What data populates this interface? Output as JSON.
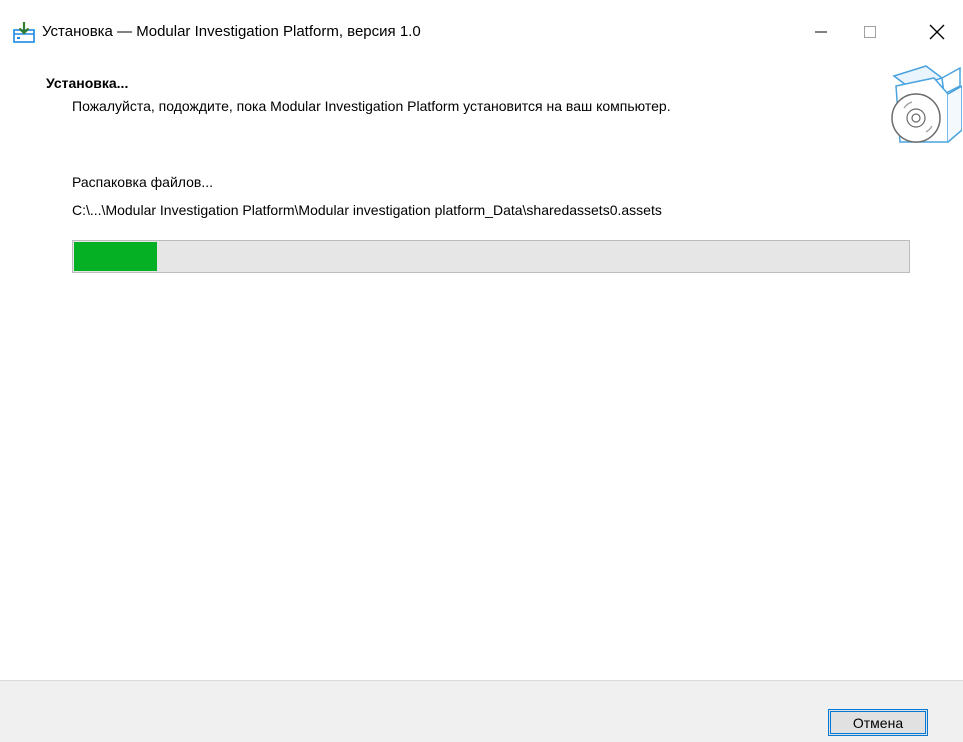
{
  "window": {
    "title": "Установка — Modular Investigation Platform, версия 1.0",
    "icon": "installer-icon"
  },
  "header": {
    "title": "Установка...",
    "subtitle": "Пожалуйста, подождите, пока Modular Investigation Platform установится на ваш компьютер.",
    "art_icon": "software-box-icon"
  },
  "main": {
    "status": "Распаковка файлов...",
    "file_path": "C:\\...\\Modular Investigation Platform\\Modular investigation platform_Data\\sharedassets0.assets",
    "progress": 0.1
  },
  "footer": {
    "cancel_label": "Отмена"
  },
  "colors": {
    "progress_fill": "#06b025",
    "progress_track": "#e6e6e6",
    "accent": "#0078d7",
    "footer_bg": "#f0f0f0"
  }
}
